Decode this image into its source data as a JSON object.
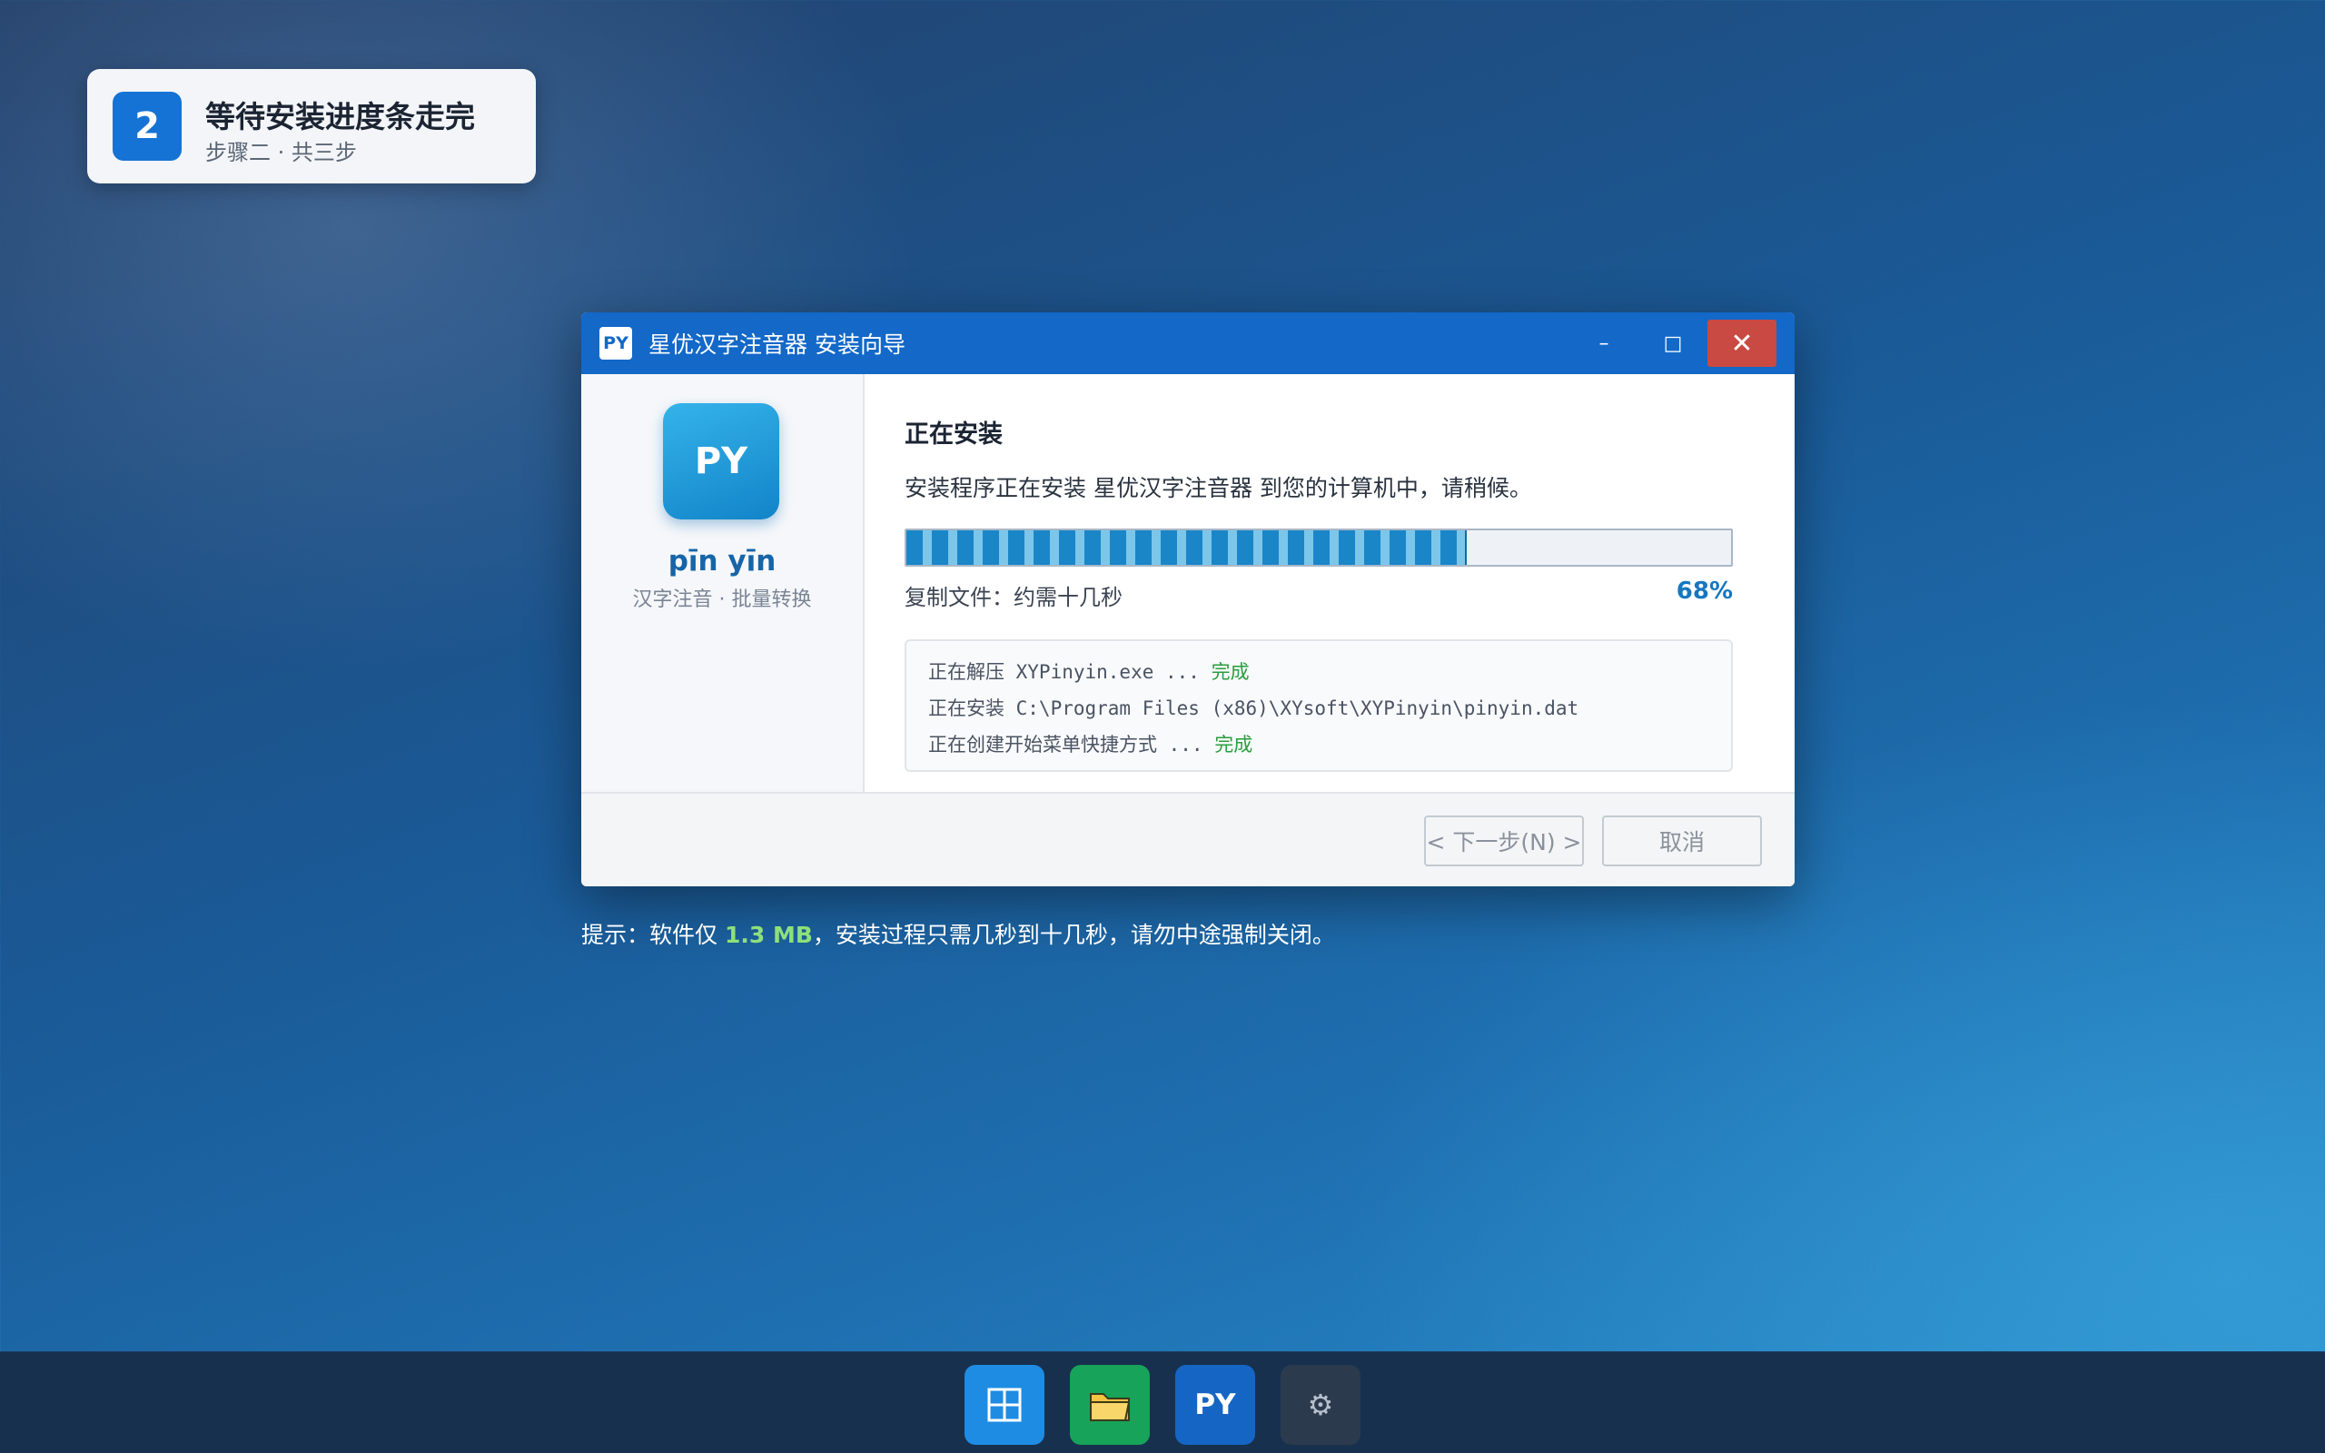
{
  "step": {
    "number": "2",
    "title": "等待安装进度条走完",
    "subtitle": "步骤二 · 共三步"
  },
  "window": {
    "icon_text": "PY",
    "title": "星优汉字注音器 安装向导",
    "controls": {
      "minimize": "–",
      "maximize": "□",
      "close": "✕"
    }
  },
  "sidebar": {
    "icon_text": "PY",
    "app_name": "pīn yīn",
    "tagline": "汉字注音 · 批量转换"
  },
  "content": {
    "heading": "正在安装",
    "description": "安装程序正在安装 星优汉字注音器 到您的计算机中，请稍候。",
    "progress": 0.68,
    "status": "复制文件：约需十几秒",
    "percent_label": "68%",
    "log": [
      {
        "text": "正在解压 XYPinyin.exe ... ",
        "done": "完成"
      },
      {
        "text": "正在安装 C:\\Program Files (x86)\\XYsoft\\XYPinyin\\pinyin.dat",
        "done": ""
      },
      {
        "text": "正在创建开始菜单快捷方式 ... ",
        "done": "完成"
      }
    ]
  },
  "footer": {
    "next_label": "< 下一步(N) >",
    "cancel_label": "取消"
  },
  "hint": {
    "prefix": "提示：软件仅 ",
    "size": "1.3 MB",
    "suffix": "，安装过程只需几秒到十几秒，请勿中途强制关闭。"
  },
  "taskbar": {
    "items": [
      {
        "name": "start",
        "icon": "windows-grid-icon"
      },
      {
        "name": "files",
        "icon": "folder-icon"
      },
      {
        "name": "pinyin",
        "icon": "py-app-icon",
        "label": "PY"
      },
      {
        "name": "settings",
        "icon": "gear-icon",
        "label": "⚙"
      }
    ]
  },
  "colors": {
    "accent": "#1368c8",
    "close": "#c94a42",
    "done": "#2a9d3e",
    "percent": "#1577c0",
    "hint_size": "#8ee07a"
  }
}
